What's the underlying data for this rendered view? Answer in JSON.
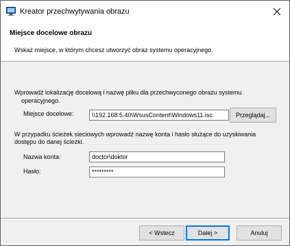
{
  "window": {
    "title": "Kreator przechwytywania obrazu"
  },
  "header": {
    "title": "Miejsce docelowe obrazu",
    "description": "Wskaż miejsce, w którym chcesz utworzyć obraz systemu operacyjnego."
  },
  "destination": {
    "instructions_line1": "Wprowadź lokalizację docelową i nazwę pliku dla przechwyconego obrazu systemu",
    "instructions_line2": "operacyjnego.",
    "label": "Miejsce docelowe:",
    "value": "\\\\192.168.5.40\\WsusContent\\Windows11.isc",
    "browse_label": "Przeglądaj..."
  },
  "credentials": {
    "instructions_line1": "W przypadku ścieżek sieciowych wprowadź nazwę konta i hasło służące do uzyskiwania",
    "instructions_line2": "dostępu do danej ścieżki.",
    "account_label": "Nazwa konta:",
    "account_value": "doctor\\doktor",
    "password_label": "Hasło:",
    "password_value": "*********"
  },
  "footer": {
    "back_label": "< Wstecz",
    "next_label": "Dalej >",
    "cancel_label": "Anuluj"
  },
  "icons": {
    "app": "capture-wizard-icon",
    "close": "close-icon"
  }
}
